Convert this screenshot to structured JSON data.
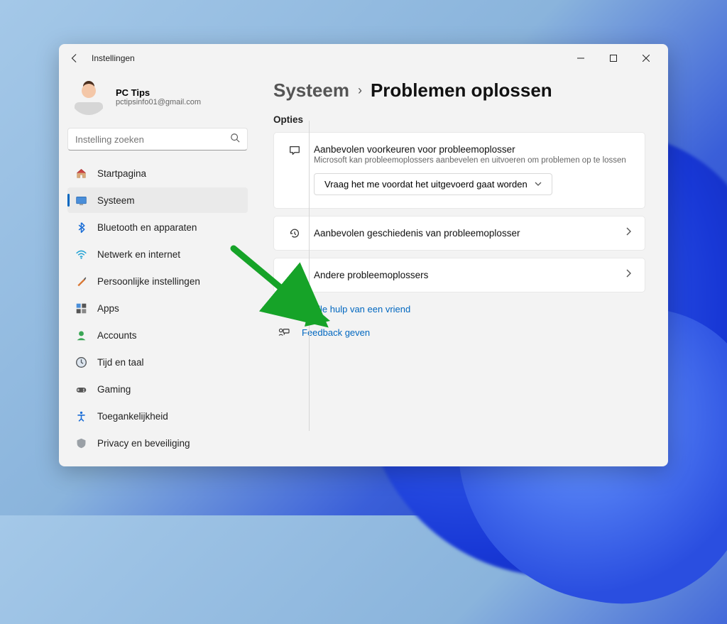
{
  "colors": {
    "accent": "#0067c0",
    "arrow": "#16a328"
  },
  "window": {
    "title": "Instellingen"
  },
  "profile": {
    "name": "PC Tips",
    "email": "pctipsinfo01@gmail.com"
  },
  "search": {
    "placeholder": "Instelling zoeken"
  },
  "sidebar": {
    "items": [
      {
        "label": "Startpagina"
      },
      {
        "label": "Systeem"
      },
      {
        "label": "Bluetooth en apparaten"
      },
      {
        "label": "Netwerk en internet"
      },
      {
        "label": "Persoonlijke instellingen"
      },
      {
        "label": "Apps"
      },
      {
        "label": "Accounts"
      },
      {
        "label": "Tijd en taal"
      },
      {
        "label": "Gaming"
      },
      {
        "label": "Toegankelijkheid"
      },
      {
        "label": "Privacy en beveiliging"
      }
    ]
  },
  "breadcrumb": {
    "parent": "Systeem",
    "current": "Problemen oplossen"
  },
  "main": {
    "section_label": "Opties",
    "recommended": {
      "title": "Aanbevolen voorkeuren voor probleemoplosser",
      "desc": "Microsoft kan probleemoplossers aanbevelen en uitvoeren om problemen op te lossen",
      "dropdown_value": "Vraag het me voordat het uitgevoerd gaat worden"
    },
    "history": {
      "title": "Aanbevolen geschiedenis van probleemoplosser"
    },
    "other": {
      "title": "Andere probleemoplossers"
    },
    "links": {
      "quick_help": "Snelle hulp van een vriend",
      "feedback": "Feedback geven"
    }
  }
}
